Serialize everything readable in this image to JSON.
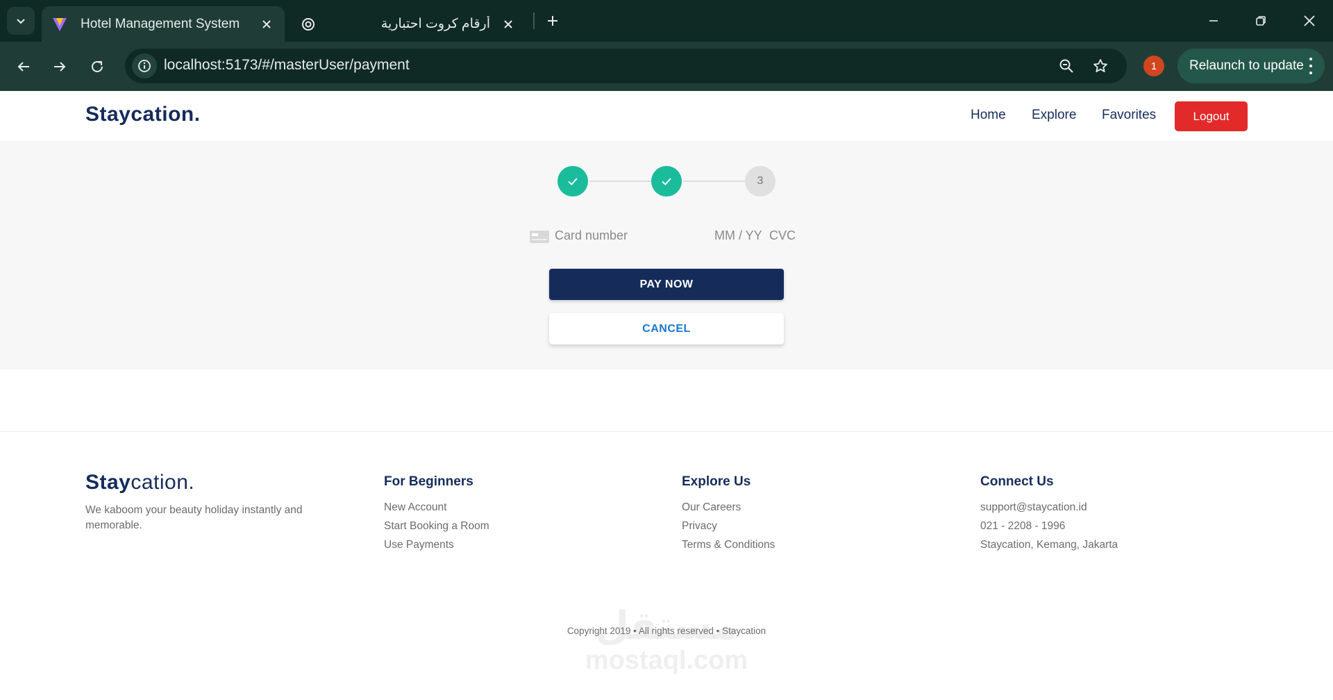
{
  "browser": {
    "tabs": [
      {
        "title": "Hotel Management System",
        "active": true
      },
      {
        "title": "أرقام كروت احتبارية",
        "active": false
      }
    ],
    "url": "localhost:5173/#/masterUser/payment",
    "profile_badge": "1",
    "relaunch_label": "Relaunch to update"
  },
  "navbar": {
    "brand": "Staycation.",
    "links": [
      "Home",
      "Explore",
      "Favorites"
    ],
    "logout_label": "Logout"
  },
  "stepper": {
    "steps": [
      {
        "state": "done",
        "label": ""
      },
      {
        "state": "done",
        "label": ""
      },
      {
        "state": "pending",
        "label": "3"
      }
    ]
  },
  "payment": {
    "card_number_placeholder": "Card number",
    "expiry_placeholder": "MM / YY",
    "cvc_placeholder": "CVC",
    "pay_label": "PAY NOW",
    "cancel_label": "CANCEL"
  },
  "footer": {
    "brand_bold": "Stay",
    "brand_rest": "cation.",
    "tagline": "We kaboom your beauty holiday instantly and memorable.",
    "columns": [
      {
        "title": "For Beginners",
        "items": [
          "New Account",
          "Start Booking a Room",
          "Use Payments"
        ]
      },
      {
        "title": "Explore Us",
        "items": [
          "Our Careers",
          "Privacy",
          "Terms & Conditions"
        ]
      },
      {
        "title": "Connect Us",
        "items": [
          "support@staycation.id",
          "021 - 2208 - 1996",
          "Staycation, Kemang, Jakarta"
        ]
      }
    ],
    "copyright": "Copyright 2019 • All rights reserved • Staycation"
  },
  "watermark": {
    "arabic": "مستقل",
    "latin": "mostaql.com"
  },
  "colors": {
    "primary": "#152c5b",
    "success": "#1abc9c",
    "danger": "#e22a2a",
    "link": "#1976d2"
  }
}
